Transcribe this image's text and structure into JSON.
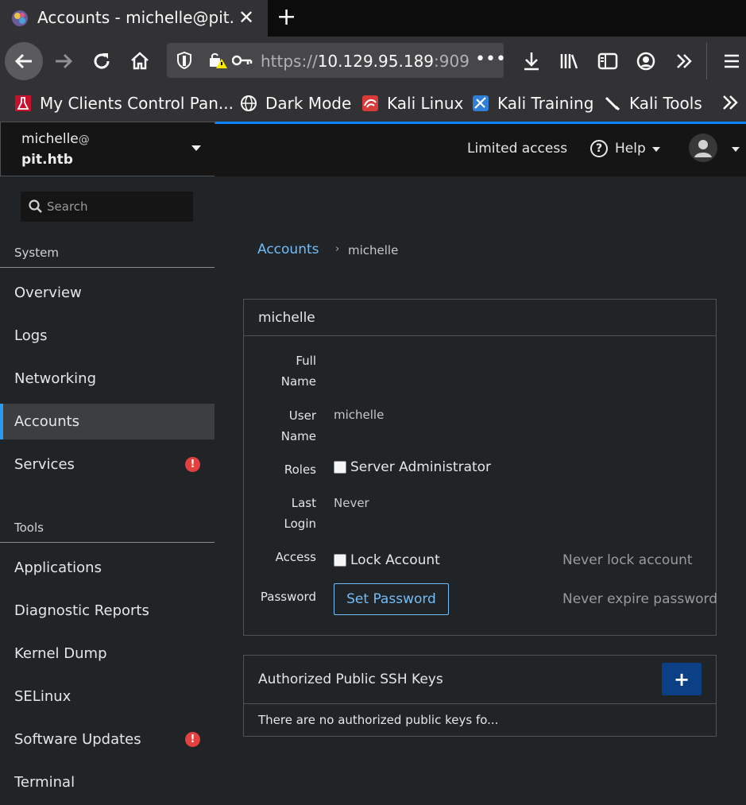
{
  "browser": {
    "tab_title": "Accounts - michelle@pit.htb",
    "url_prefix": "https://",
    "url_host": "10.129.95.189",
    "url_port": ":909",
    "bookmarks": [
      {
        "label": "My Clients Control Pan..."
      },
      {
        "label": "Dark Mode"
      },
      {
        "label": "Kali Linux"
      },
      {
        "label": "Kali Training"
      },
      {
        "label": "Kali Tools"
      }
    ]
  },
  "host": {
    "user": "michelle",
    "at": "@",
    "name": "pit.htb"
  },
  "search": {
    "placeholder": "Search"
  },
  "sidebar": {
    "system_label": "System",
    "system_items": [
      {
        "label": "Overview"
      },
      {
        "label": "Logs"
      },
      {
        "label": "Networking"
      },
      {
        "label": "Accounts"
      },
      {
        "label": "Services"
      }
    ],
    "tools_label": "Tools",
    "tools_items": [
      {
        "label": "Applications"
      },
      {
        "label": "Diagnostic Reports"
      },
      {
        "label": "Kernel Dump"
      },
      {
        "label": "SELinux"
      },
      {
        "label": "Software Updates"
      },
      {
        "label": "Terminal"
      }
    ]
  },
  "topbar": {
    "limited_access": "Limited access",
    "help": "Help"
  },
  "breadcrumb": {
    "parent": "Accounts",
    "separator": "›",
    "current": "michelle"
  },
  "account": {
    "title": "michelle",
    "full_name_label_1": "Full",
    "full_name_label_2": "Name",
    "user_name_label_1": "User",
    "user_name_label_2": "Name",
    "user_name_value": "michelle",
    "roles_label": "Roles",
    "role_option": "Server Administrator",
    "last_login_label_1": "Last",
    "last_login_label_2": "Login",
    "last_login_value": "Never",
    "access_label": "Access",
    "lock_option": "Lock Account",
    "lock_status": "Never lock account",
    "password_label": "Password",
    "set_password": "Set Password",
    "password_status": "Never expire password"
  },
  "ssh": {
    "title": "Authorized Public SSH Keys",
    "add": "+",
    "empty": "There are no authorized public keys fo..."
  },
  "colors": {
    "accent": "#73bcf7",
    "active_border": "#2b9af3",
    "alert": "#e3403f",
    "add_button": "#0b3f86"
  }
}
